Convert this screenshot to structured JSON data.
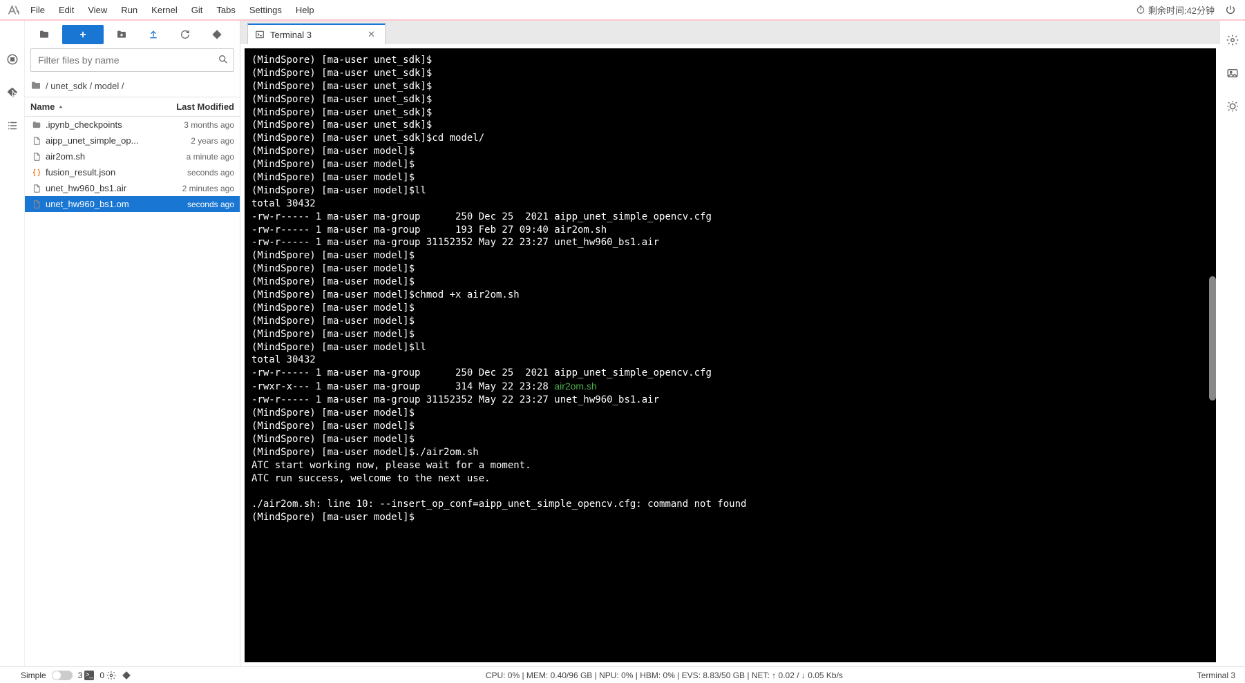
{
  "menu": {
    "items": [
      "File",
      "Edit",
      "View",
      "Run",
      "Kernel",
      "Git",
      "Tabs",
      "Settings",
      "Help"
    ]
  },
  "topright": {
    "timer_label": "剩余时间:42分钟"
  },
  "fb_toolbar": {},
  "filter": {
    "placeholder": "Filter files by name"
  },
  "breadcrumb": {
    "segments": [
      "/",
      "unet_sdk",
      "/",
      "model",
      "/"
    ]
  },
  "columns": {
    "name": "Name",
    "modified": "Last Modified"
  },
  "files": [
    {
      "icon": "folder",
      "name": ".ipynb_checkpoints",
      "modified": "3 months ago",
      "selected": false
    },
    {
      "icon": "file",
      "name": "aipp_unet_simple_op...",
      "modified": "2 years ago",
      "selected": false
    },
    {
      "icon": "file",
      "name": "air2om.sh",
      "modified": "a minute ago",
      "selected": false
    },
    {
      "icon": "json",
      "name": "fusion_result.json",
      "modified": "seconds ago",
      "selected": false
    },
    {
      "icon": "file",
      "name": "unet_hw960_bs1.air",
      "modified": "2 minutes ago",
      "selected": false
    },
    {
      "icon": "file",
      "name": "unet_hw960_bs1.om",
      "modified": "seconds ago",
      "selected": true
    }
  ],
  "tab": {
    "label": "Terminal 3"
  },
  "terminal_lines": [
    {
      "t": "(MindSpore) [ma-user unet_sdk]$"
    },
    {
      "t": "(MindSpore) [ma-user unet_sdk]$"
    },
    {
      "t": "(MindSpore) [ma-user unet_sdk]$"
    },
    {
      "t": "(MindSpore) [ma-user unet_sdk]$"
    },
    {
      "t": "(MindSpore) [ma-user unet_sdk]$"
    },
    {
      "t": "(MindSpore) [ma-user unet_sdk]$"
    },
    {
      "t": "(MindSpore) [ma-user unet_sdk]$cd model/"
    },
    {
      "t": "(MindSpore) [ma-user model]$"
    },
    {
      "t": "(MindSpore) [ma-user model]$"
    },
    {
      "t": "(MindSpore) [ma-user model]$"
    },
    {
      "t": "(MindSpore) [ma-user model]$ll"
    },
    {
      "t": "total 30432"
    },
    {
      "t": "-rw-r----- 1 ma-user ma-group      250 Dec 25  2021 aipp_unet_simple_opencv.cfg"
    },
    {
      "t": "-rw-r----- 1 ma-user ma-group      193 Feb 27 09:40 air2om.sh"
    },
    {
      "t": "-rw-r----- 1 ma-user ma-group 31152352 May 22 23:27 unet_hw960_bs1.air"
    },
    {
      "t": "(MindSpore) [ma-user model]$"
    },
    {
      "t": "(MindSpore) [ma-user model]$"
    },
    {
      "t": "(MindSpore) [ma-user model]$"
    },
    {
      "t": "(MindSpore) [ma-user model]$chmod +x air2om.sh"
    },
    {
      "t": "(MindSpore) [ma-user model]$"
    },
    {
      "t": "(MindSpore) [ma-user model]$"
    },
    {
      "t": "(MindSpore) [ma-user model]$"
    },
    {
      "t": "(MindSpore) [ma-user model]$ll"
    },
    {
      "t": "total 30432"
    },
    {
      "t": "-rw-r----- 1 ma-user ma-group      250 Dec 25  2021 aipp_unet_simple_opencv.cfg"
    },
    {
      "t": "-rwxr-x--- 1 ma-user ma-group      314 May 22 23:28 ",
      "g": "air2om.sh"
    },
    {
      "t": "-rw-r----- 1 ma-user ma-group 31152352 May 22 23:27 unet_hw960_bs1.air"
    },
    {
      "t": "(MindSpore) [ma-user model]$"
    },
    {
      "t": "(MindSpore) [ma-user model]$"
    },
    {
      "t": "(MindSpore) [ma-user model]$"
    },
    {
      "t": "(MindSpore) [ma-user model]$./air2om.sh"
    },
    {
      "t": "ATC start working now, please wait for a moment."
    },
    {
      "t": "ATC run success, welcome to the next use."
    },
    {
      "t": ""
    },
    {
      "t": "./air2om.sh: line 10: --insert_op_conf=aipp_unet_simple_opencv.cfg: command not found"
    },
    {
      "t": "(MindSpore) [ma-user model]$"
    }
  ],
  "status": {
    "simple": "Simple",
    "count1": "3",
    "count2": "0",
    "center": "CPU: 0%  |  MEM: 0.40/96 GB  |  NPU: 0%  |  HBM: 0%  |  EVS: 8.83/50 GB  |  NET: ↑ 0.02 / ↓ 0.05 Kb/s",
    "right": "Terminal 3"
  }
}
